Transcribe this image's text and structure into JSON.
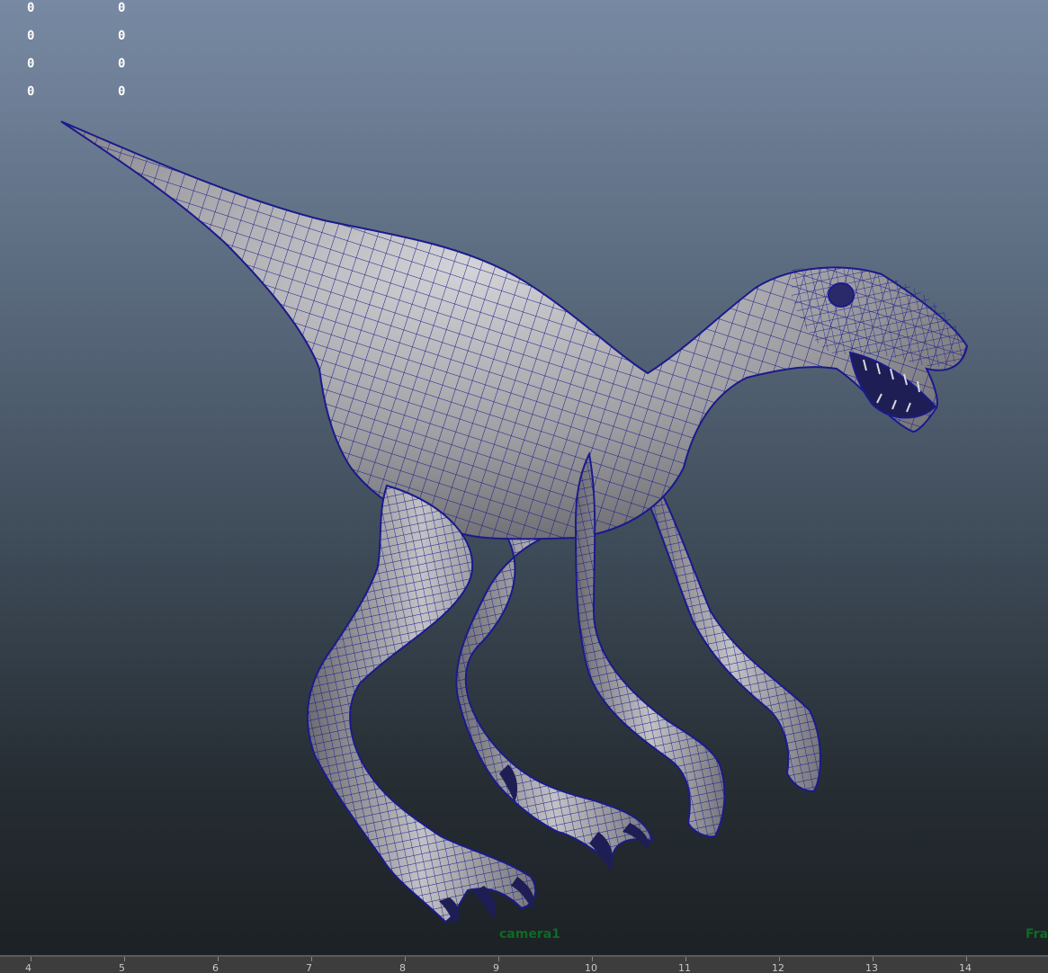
{
  "hud": {
    "col1": [
      "0",
      "0",
      "0",
      "0"
    ],
    "col2": [
      "0",
      "0",
      "0",
      "0"
    ]
  },
  "viewport": {
    "camera_label": "camera1",
    "frame_label": "Fra"
  },
  "model": {
    "object": "dinosaur-mesh",
    "wireframe_color": "#1a1a8c",
    "shade_color": "#a6a6aa"
  },
  "timeline": {
    "ticks": [
      "4",
      "5",
      "6",
      "7",
      "8",
      "9",
      "10",
      "11",
      "12",
      "13",
      "14"
    ]
  },
  "colors": {
    "hud_text": "#ffffff",
    "camera_label": "#0e6a24",
    "timeline_bg": "#3d3d3d"
  }
}
